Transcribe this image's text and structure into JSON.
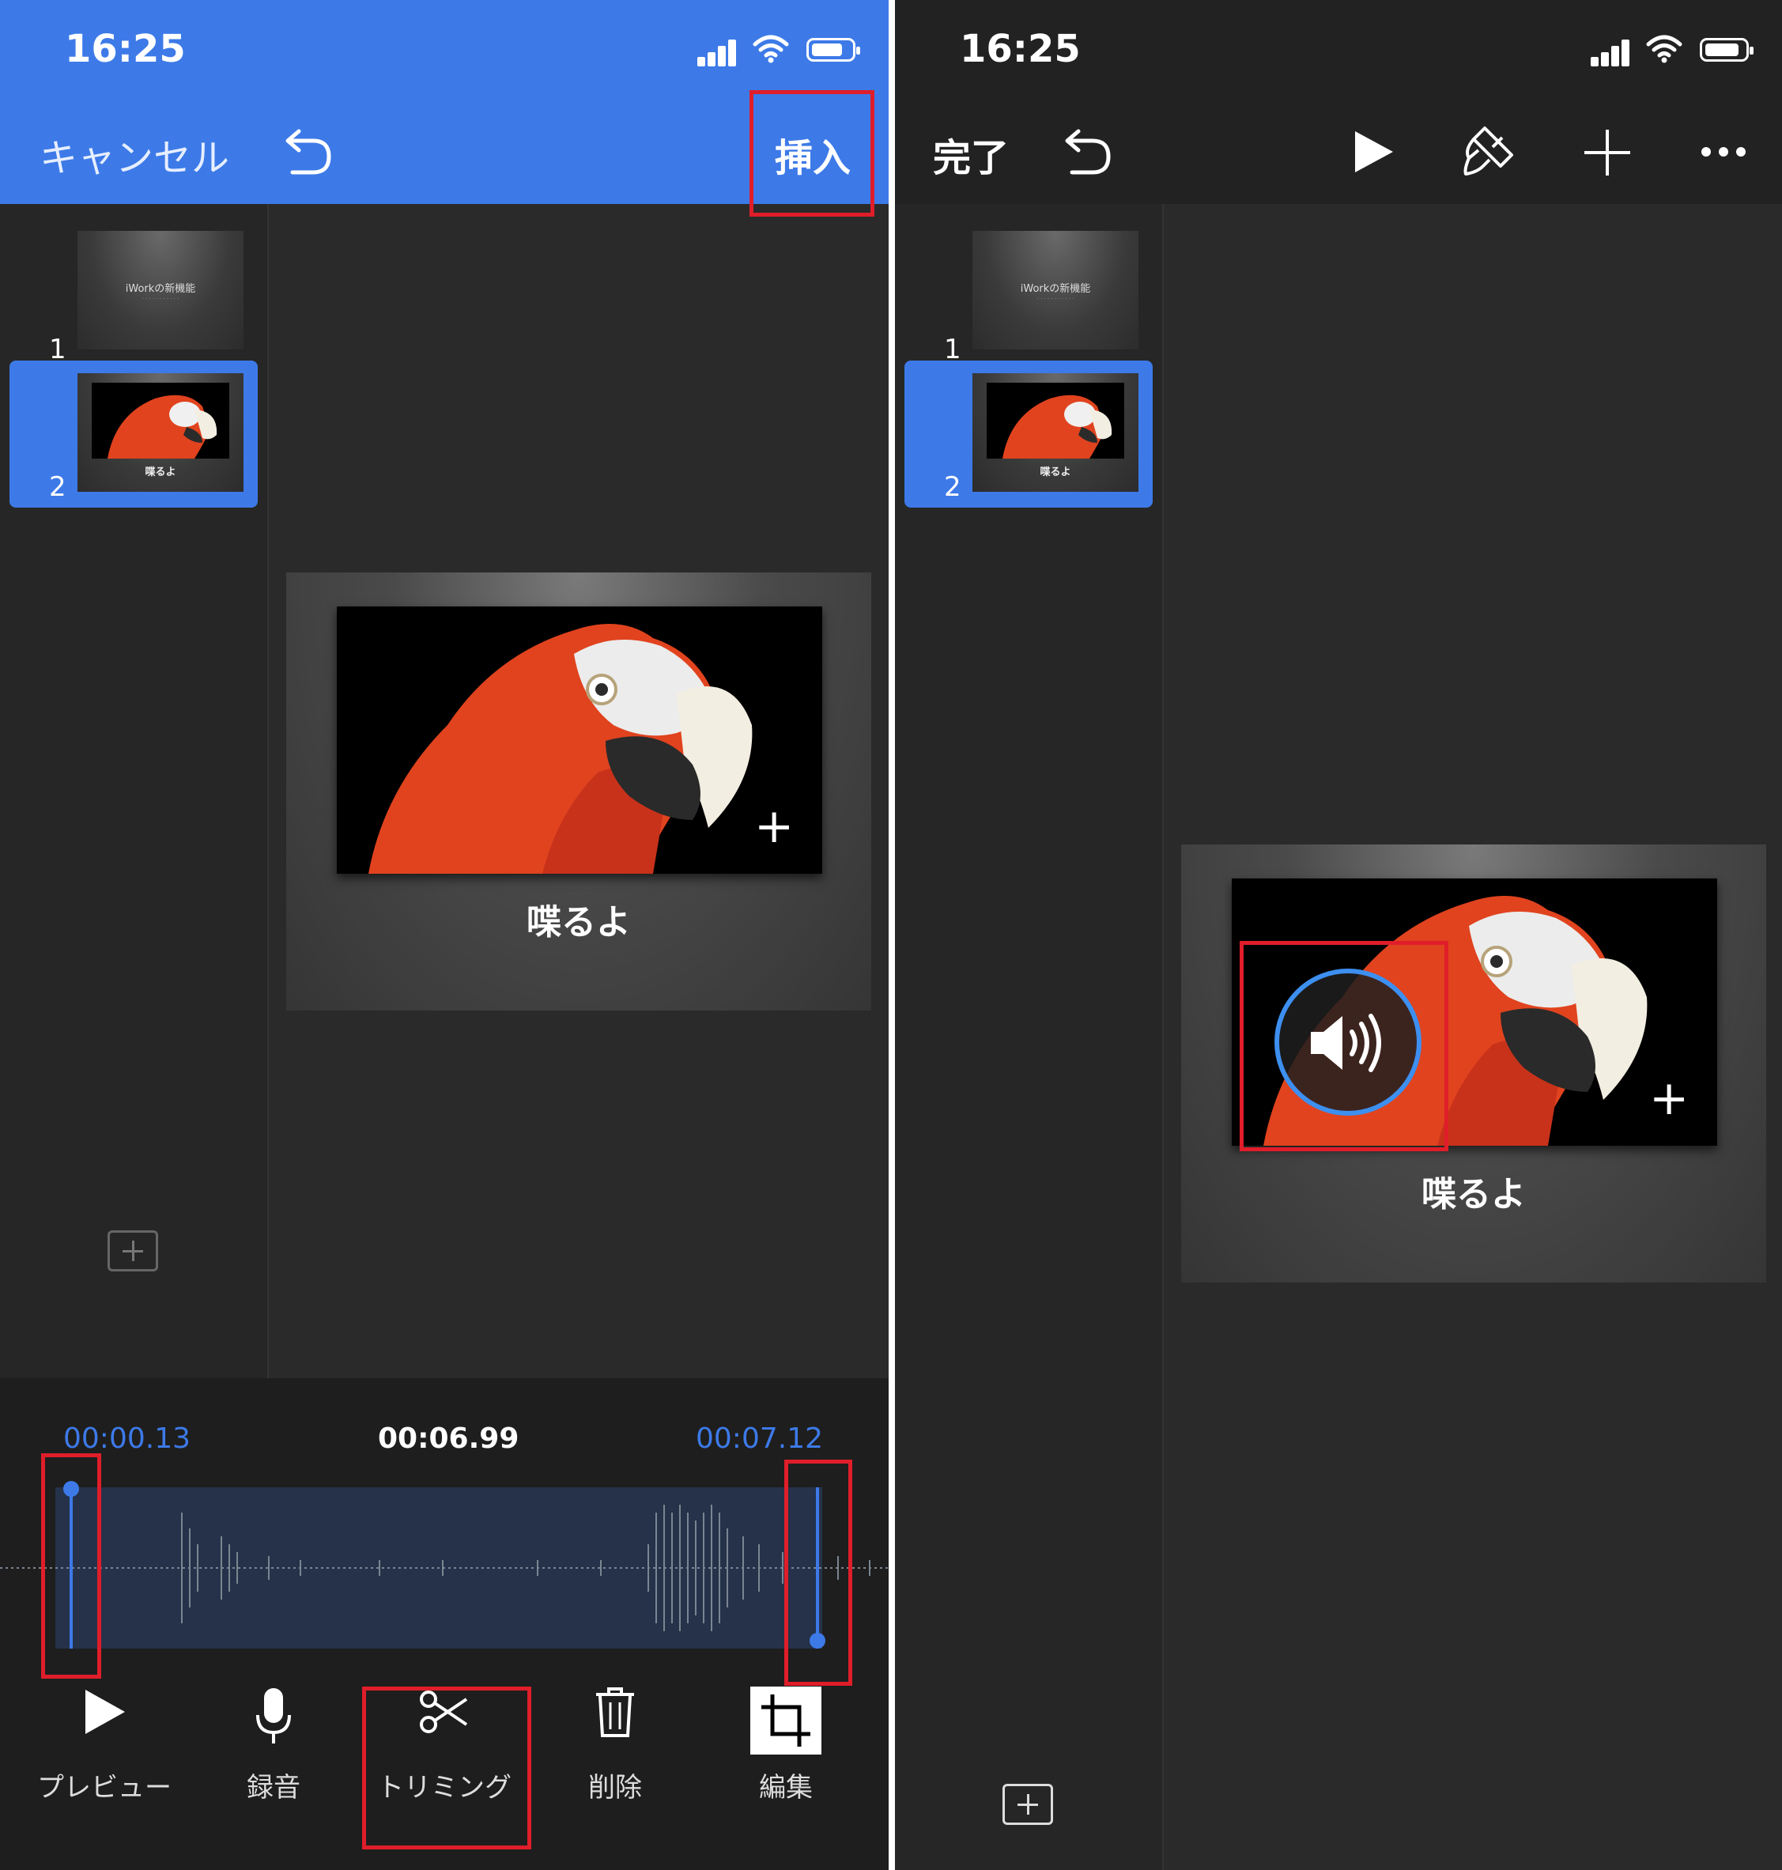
{
  "left": {
    "status_bar": {
      "time": "16:25"
    },
    "top_bar": {
      "cancel_label": "キャンセル",
      "insert_label": "挿入"
    },
    "slides": [
      {
        "number": "1",
        "title": "iWorkの新機能",
        "subtitle": "",
        "selected": false
      },
      {
        "number": "2",
        "caption": "喋るよ",
        "selected": true
      }
    ],
    "canvas": {
      "caption": "喋るよ"
    },
    "audio_editor": {
      "start_time": "00:00.13",
      "current_time": "00:06.99",
      "end_time": "00:07.12"
    },
    "toolbar": {
      "preview_label": "プレビュー",
      "record_label": "録音",
      "trim_label": "トリミング",
      "delete_label": "削除",
      "edit_label": "編集"
    }
  },
  "right": {
    "status_bar": {
      "time": "16:25"
    },
    "top_bar": {
      "done_label": "完了"
    },
    "slides": [
      {
        "number": "1",
        "title": "iWorkの新機能",
        "selected": false
      },
      {
        "number": "2",
        "caption": "喋るよ",
        "selected": true
      }
    ],
    "canvas": {
      "caption": "喋るよ"
    }
  },
  "colors": {
    "accent": "#3d7ae8",
    "highlight": "#e01e2a",
    "background": "#2a2a2a"
  }
}
